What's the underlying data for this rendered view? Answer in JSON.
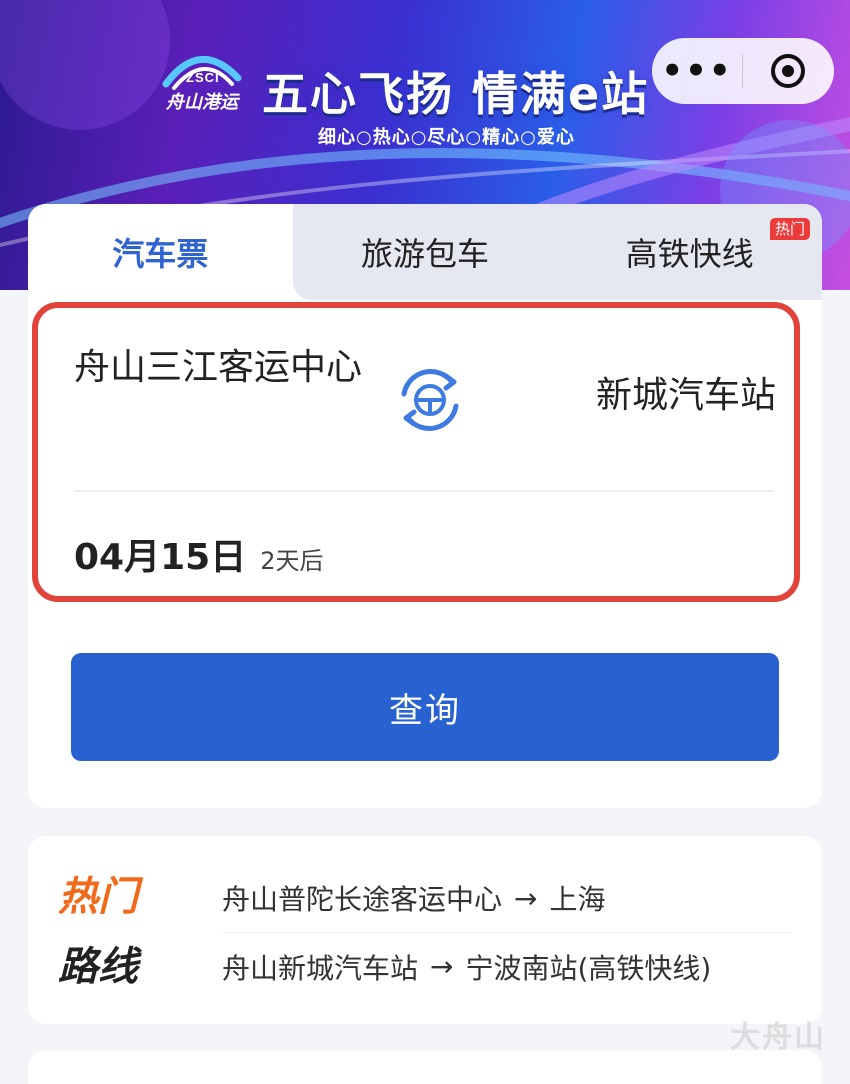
{
  "banner": {
    "logo_abbr": "ZSCI",
    "logo_text": "舟山港运",
    "slogan": "五心飞扬 情满e站",
    "sub_slogan": "细心○热心○尽心○精心○爱心",
    "capsule": {
      "more_label": "•••"
    }
  },
  "tabs": [
    {
      "label": "汽车票",
      "active": true
    },
    {
      "label": "旅游包车",
      "active": false
    },
    {
      "label": "高铁快线",
      "active": false,
      "badge": "热门"
    }
  ],
  "route": {
    "from": "舟山三江客运中心",
    "to": "新城汽车站",
    "date": "04月15日",
    "relative_date": "2天后"
  },
  "search_button": {
    "label": "查询"
  },
  "hot_routes": {
    "title_line1": "热门",
    "title_line2": "路线",
    "items": [
      {
        "from": "舟山普陀长途客运中心",
        "arrow": "→",
        "to": "上海"
      },
      {
        "from": "舟山新城汽车站",
        "arrow": "→",
        "to": "宁波南站(高铁快线)"
      }
    ]
  },
  "watermark": "大舟山",
  "colors": {
    "accent": "#2862d1",
    "active_tab": "#2f63d0",
    "highlight_border": "#e2433b",
    "hot_orange": "#f06a1a",
    "badge_red": "#ec3b3b"
  }
}
